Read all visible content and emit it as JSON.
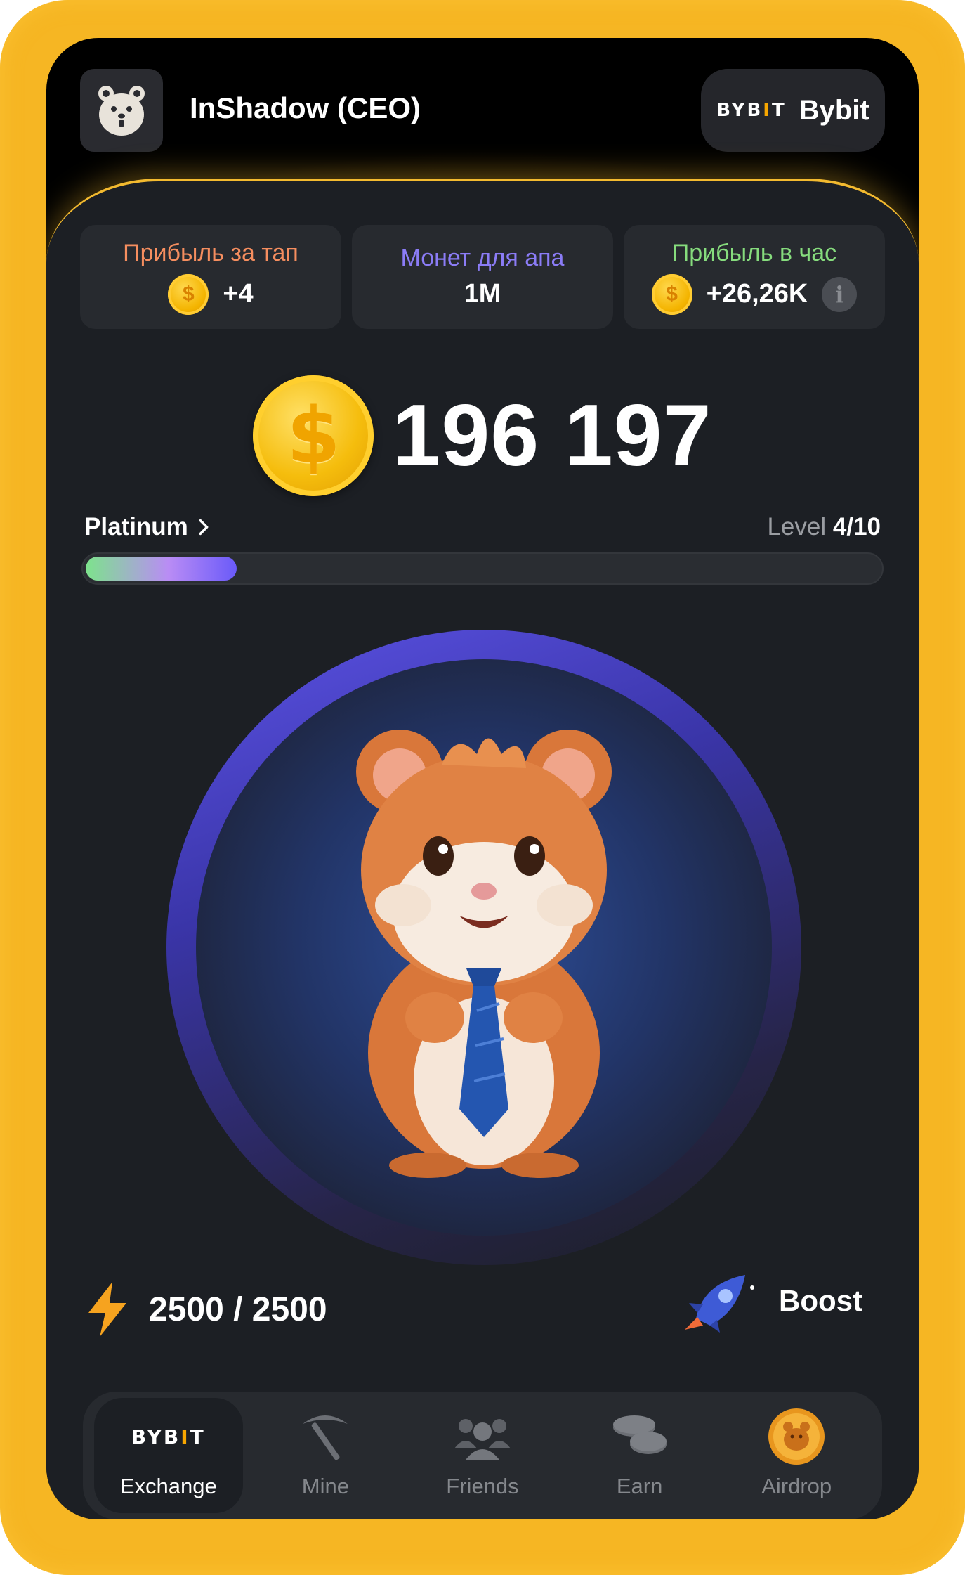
{
  "header": {
    "username": "InShadow (CEO)",
    "exchange": {
      "logo_text": "BYB",
      "logo_i": "I",
      "logo_tail": "T",
      "name": "Bybit"
    }
  },
  "stats": [
    {
      "title": "Прибыль за тап",
      "value": "+4",
      "title_color": "#f68e5f",
      "icon": "coin-icon"
    },
    {
      "title": "Монет для апа",
      "value": "1M",
      "title_color": "#8b7cf6",
      "icon": ""
    },
    {
      "title": "Прибыль в час",
      "value": "+26,26K",
      "title_color": "#86dc7d",
      "icon": "coin-icon"
    }
  ],
  "balance": "196 197",
  "league": {
    "name": "Platinum",
    "level_label": "Level",
    "level_value": "4/10",
    "progress_fraction": 0.19
  },
  "energy": {
    "value": "2500 / 2500"
  },
  "boost": {
    "label": "Boost"
  },
  "nav": [
    {
      "label": "Exchange",
      "icon": "bybit-logo-icon",
      "active": true
    },
    {
      "label": "Mine",
      "icon": "pickaxe-icon",
      "active": false
    },
    {
      "label": "Friends",
      "icon": "friends-icon",
      "active": false
    },
    {
      "label": "Earn",
      "icon": "coins-stack-icon",
      "active": false
    },
    {
      "label": "Airdrop",
      "icon": "hamster-coin-icon",
      "active": false
    }
  ],
  "colors": {
    "frame": "#f6b623",
    "panel": "#1c1f24",
    "accent_gold": "#f3ba2f",
    "card": "#272a2f"
  }
}
